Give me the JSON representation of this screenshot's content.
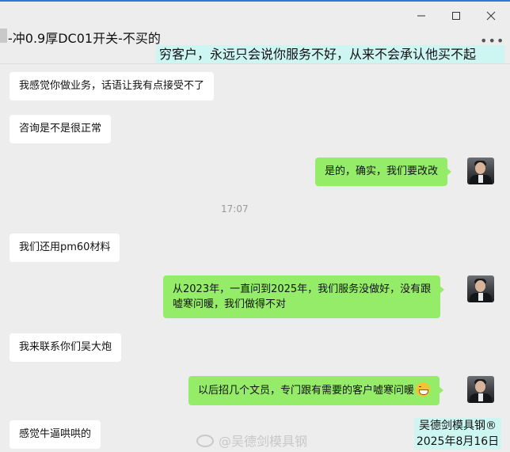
{
  "window": {
    "title": "-冲0.9厚DC01开关-不买的",
    "more_label": "•••"
  },
  "overlay_caption": "穷客户，永远只会说你服务不好，从来不会承认他买不起",
  "messages": [
    {
      "side": "left",
      "text": "我感觉你做业务，话语让我有点接受不了"
    },
    {
      "side": "left",
      "text": "咨询是不是很正常"
    },
    {
      "side": "right",
      "text": "是的，确实，我们要改改"
    },
    {
      "side": "left",
      "text": "我们还用pm60材料"
    },
    {
      "side": "right",
      "line1": "从2023年，一直问到2025年，我们服务没做好，没有跟",
      "line2": "嘘寒问暖，我们做得不对"
    },
    {
      "side": "left",
      "text": "我来联系你们吴大炮"
    },
    {
      "side": "right",
      "text": "以后招几个文员，专门跟有需要的客户嘘寒问暖"
    },
    {
      "side": "left",
      "text": "感觉牛逼哄哄的"
    }
  ],
  "timestamp": "17:07",
  "watermark": "@吴德剑模具钢",
  "stamp": {
    "line1": "吴德剑模具钢®",
    "line2": "2025年8月16日"
  },
  "colors": {
    "chat_bg": "#ededed",
    "left_bubble": "#ffffff",
    "right_bubble": "#95ec69",
    "caption_bg": "#cdf6f3"
  },
  "icons": [
    "minimize-icon",
    "maximize-icon",
    "close-icon",
    "more-icon",
    "grin-emoji-icon",
    "weibo-icon"
  ]
}
